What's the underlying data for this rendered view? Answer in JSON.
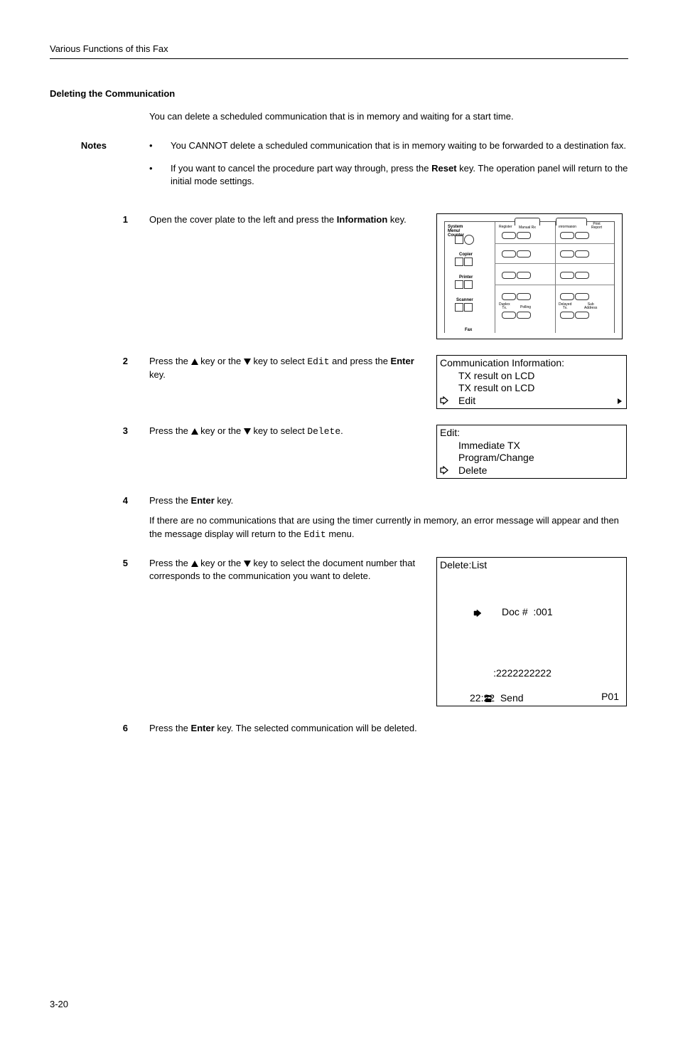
{
  "header": {
    "breadcrumb": "Various Functions of this Fax"
  },
  "section": {
    "title": "Deleting the Communication"
  },
  "intro": "You can delete a scheduled communication that is in memory and waiting for a start time.",
  "notes": {
    "label": "Notes",
    "items": [
      "You CANNOT delete a scheduled communication that is in memory waiting to be forwarded to a destination fax.",
      {
        "pre": "If you want to cancel the procedure part way through, press the ",
        "bold": "Reset",
        "post": " key. The operation panel will return to the initial mode settings."
      }
    ]
  },
  "steps": {
    "s1": {
      "num": "1",
      "pre": "Open the cover plate to the left and press the ",
      "bold": "Information",
      "post": " key."
    },
    "s2": {
      "num": "2",
      "pre1": "Press the ",
      "mid1": " key or the ",
      "mid2": " key to select ",
      "code": "Edit",
      "mid3": " and press the ",
      "bold": "Enter",
      "post": " key."
    },
    "s3": {
      "num": "3",
      "pre1": "Press the ",
      "mid1": " key or the ",
      "mid2": " key to select ",
      "code": "Delete",
      "post": "."
    },
    "s4": {
      "num": "4",
      "pre": "Press the ",
      "bold": "Enter",
      "post": " key.",
      "para_pre": "If there are no communications that are using the timer currently in memory, an error message will appear and then the message display will return to the ",
      "para_code": "Edit",
      "para_post": " menu."
    },
    "s5": {
      "num": "5",
      "pre1": "Press the ",
      "mid1": " key or the ",
      "mid2": " key to select the document number that corresponds to the communication you want to delete."
    },
    "s6": {
      "num": "6",
      "pre": "Press the ",
      "bold": "Enter",
      "post": " key. The selected communication will be deleted."
    }
  },
  "lcd": {
    "box1": {
      "l1": "Communication Information:",
      "l2": "TX result on LCD",
      "l3": "TX result on LCD",
      "l4": "Edit"
    },
    "box2": {
      "l1": "Edit:",
      "l2": "Immediate TX",
      "l3": "Program/Change",
      "l4": "Delete"
    },
    "box3": {
      "l1": "Delete:List",
      "l2": "Doc #  :001",
      "l3": ":2222222222",
      "l4": "22:22  Send",
      "page": "P01"
    }
  },
  "panel": {
    "labels": {
      "sysmenu": "System Menu/\nCounter",
      "copier": "Copier",
      "printer": "Printer",
      "scanner": "Scanner",
      "fax": "Fax",
      "register": "Register",
      "manualrx": "FAX\nManual Rx",
      "information": "Information",
      "printreport": "Print\nReport",
      "duplextx": "Duplex\nTx.",
      "polling": "Polling",
      "delayedtx": "Delayed\nTx.",
      "subaddress": "Sub\nAddress"
    }
  },
  "footer": {
    "page": "3-20"
  }
}
